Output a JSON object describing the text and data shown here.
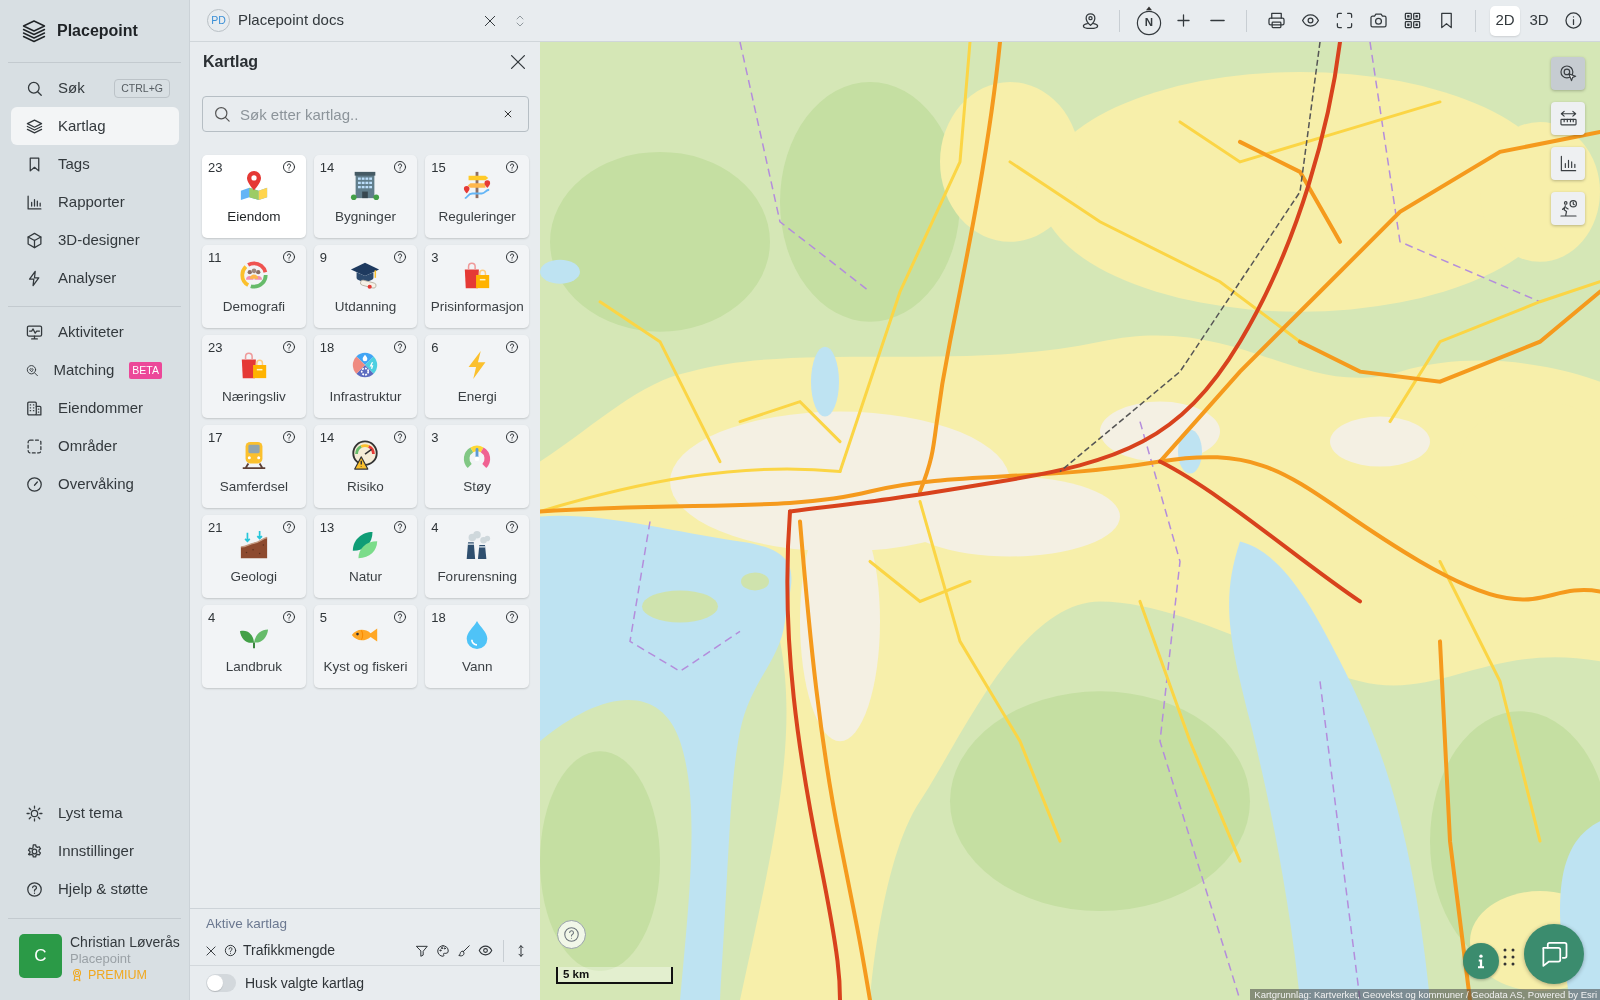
{
  "sidebar": {
    "logo": "Placepoint",
    "sections": [
      {
        "items": [
          {
            "label": "Søk",
            "shortcut": "CTRL+G",
            "selected": false
          },
          {
            "label": "Kartlag",
            "selected": true
          },
          {
            "label": "Tags",
            "selected": false
          },
          {
            "label": "Rapporter",
            "selected": false
          },
          {
            "label": "3D-designer",
            "selected": false
          },
          {
            "label": "Analyser",
            "selected": false
          }
        ]
      },
      {
        "items": [
          {
            "label": "Aktiviteter",
            "selected": false
          },
          {
            "label": "Matching",
            "badge": "BETA",
            "selected": false
          },
          {
            "label": "Eiendommer",
            "selected": false
          },
          {
            "label": "Områder",
            "selected": false
          },
          {
            "label": "Overvåking",
            "selected": false
          }
        ]
      }
    ],
    "footer_items": [
      {
        "label": "Lyst tema"
      },
      {
        "label": "Innstillinger"
      },
      {
        "label": "Hjelp & støtte"
      }
    ],
    "user": {
      "initial": "C",
      "name": "Christian Løverås",
      "organization": "Placepoint",
      "plan": "PREMIUM"
    }
  },
  "topbar": {
    "workspace": {
      "initials": "PD",
      "name": "Placepoint docs"
    },
    "compass": "N",
    "view_modes": [
      {
        "label": "2D",
        "selected": true
      },
      {
        "label": "3D",
        "selected": false
      }
    ]
  },
  "panel": {
    "title": "Kartlag",
    "search": {
      "placeholder": "Søk etter kartlag.."
    },
    "categories": [
      {
        "count": "23",
        "label": "Eiendom",
        "selected": true
      },
      {
        "count": "14",
        "label": "Bygninger",
        "selected": false
      },
      {
        "count": "15",
        "label": "Reguleringer",
        "selected": false
      },
      {
        "count": "11",
        "label": "Demografi",
        "selected": false
      },
      {
        "count": "9",
        "label": "Utdanning",
        "selected": false
      },
      {
        "count": "3",
        "label": "Prisinformasjon",
        "selected": false
      },
      {
        "count": "23",
        "label": "Næringsliv",
        "selected": false
      },
      {
        "count": "18",
        "label": "Infrastruktur",
        "selected": false
      },
      {
        "count": "6",
        "label": "Energi",
        "selected": false
      },
      {
        "count": "17",
        "label": "Samferdsel",
        "selected": false
      },
      {
        "count": "14",
        "label": "Risiko",
        "selected": false
      },
      {
        "count": "3",
        "label": "Støy",
        "selected": false
      },
      {
        "count": "21",
        "label": "Geologi",
        "selected": false
      },
      {
        "count": "13",
        "label": "Natur",
        "selected": false
      },
      {
        "count": "4",
        "label": "Forurensning",
        "selected": false
      },
      {
        "count": "4",
        "label": "Landbruk",
        "selected": false
      },
      {
        "count": "5",
        "label": "Kyst og fiskeri",
        "selected": false
      },
      {
        "count": "18",
        "label": "Vann",
        "selected": false
      }
    ],
    "active": {
      "title": "Aktive kartlag",
      "layers": [
        {
          "name": "Trafikkmengde"
        }
      ]
    },
    "remember": {
      "label": "Husk valgte kartlag",
      "on": false
    }
  },
  "map": {
    "tools": [
      {
        "selected": true
      },
      {
        "selected": false
      },
      {
        "selected": false
      },
      {
        "selected": false
      }
    ],
    "scale": "5 km",
    "attribution": "Kartgrunnlag: Kartverket, Geovekst og kommuner / Geodata AS, Powered by Esri"
  }
}
